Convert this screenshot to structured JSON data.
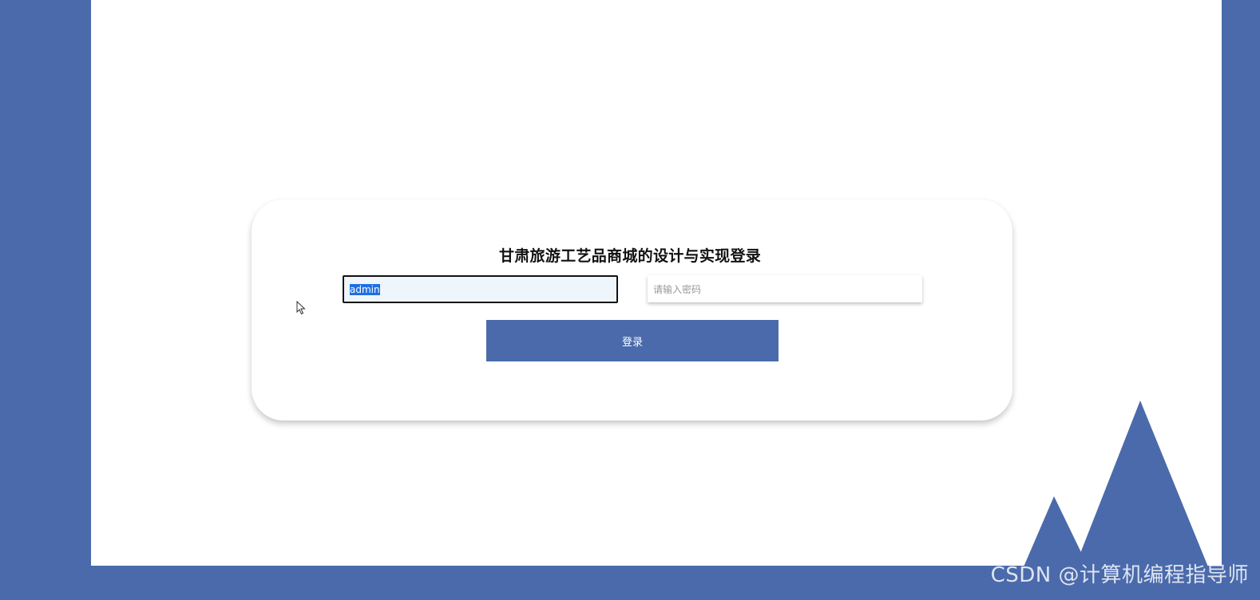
{
  "page": {
    "title": "甘肃旅游工艺品商城的设计与实现登录"
  },
  "form": {
    "username_value": "admin",
    "password_placeholder": "请输入密码",
    "login_label": "登录"
  },
  "watermark": "CSDN @计算机编程指导师",
  "colors": {
    "frame": "#4a6aab",
    "button": "#4a6aab",
    "background": "#ffffff",
    "selection": "#1f6fe3"
  },
  "icons": {
    "cursor": "mouse-pointer-icon",
    "decoration": "mountain-icon"
  }
}
